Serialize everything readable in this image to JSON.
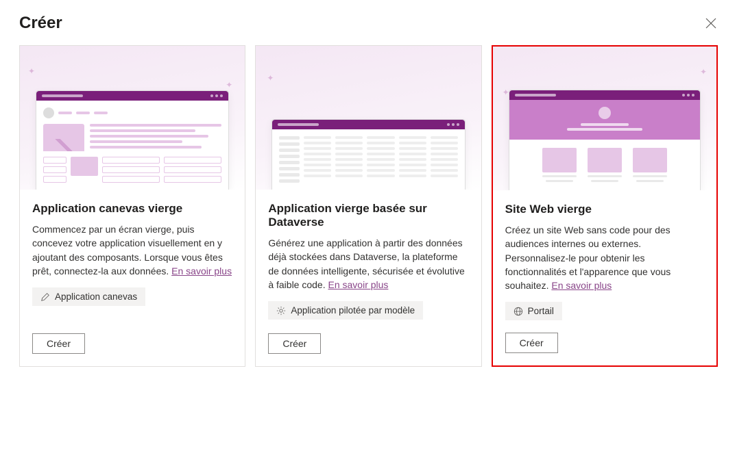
{
  "header": {
    "title": "Créer"
  },
  "cards": [
    {
      "title": "Application canevas vierge",
      "description": "Commencez par un écran vierge, puis concevez votre application visuellement en y ajoutant des composants. Lorsque vous êtes prêt, connectez-la aux données. ",
      "learn_more": "En savoir plus",
      "tag": "Application canevas",
      "button": "Créer"
    },
    {
      "title": "Application vierge basée sur Dataverse",
      "description": "Générez une application à partir des données déjà stockées dans Dataverse, la plateforme de données intelligente, sécurisée et évolutive à faible code. ",
      "learn_more": "En savoir plus",
      "tag": "Application pilotée par modèle",
      "button": "Créer"
    },
    {
      "title": "Site Web vierge",
      "description": "Créez un site Web sans code pour des audiences internes ou externes. Personnalisez-le pour obtenir les fonctionnalités et l'apparence que vous souhaitez. ",
      "learn_more": "En savoir plus",
      "tag": "Portail",
      "button": "Créer"
    }
  ]
}
